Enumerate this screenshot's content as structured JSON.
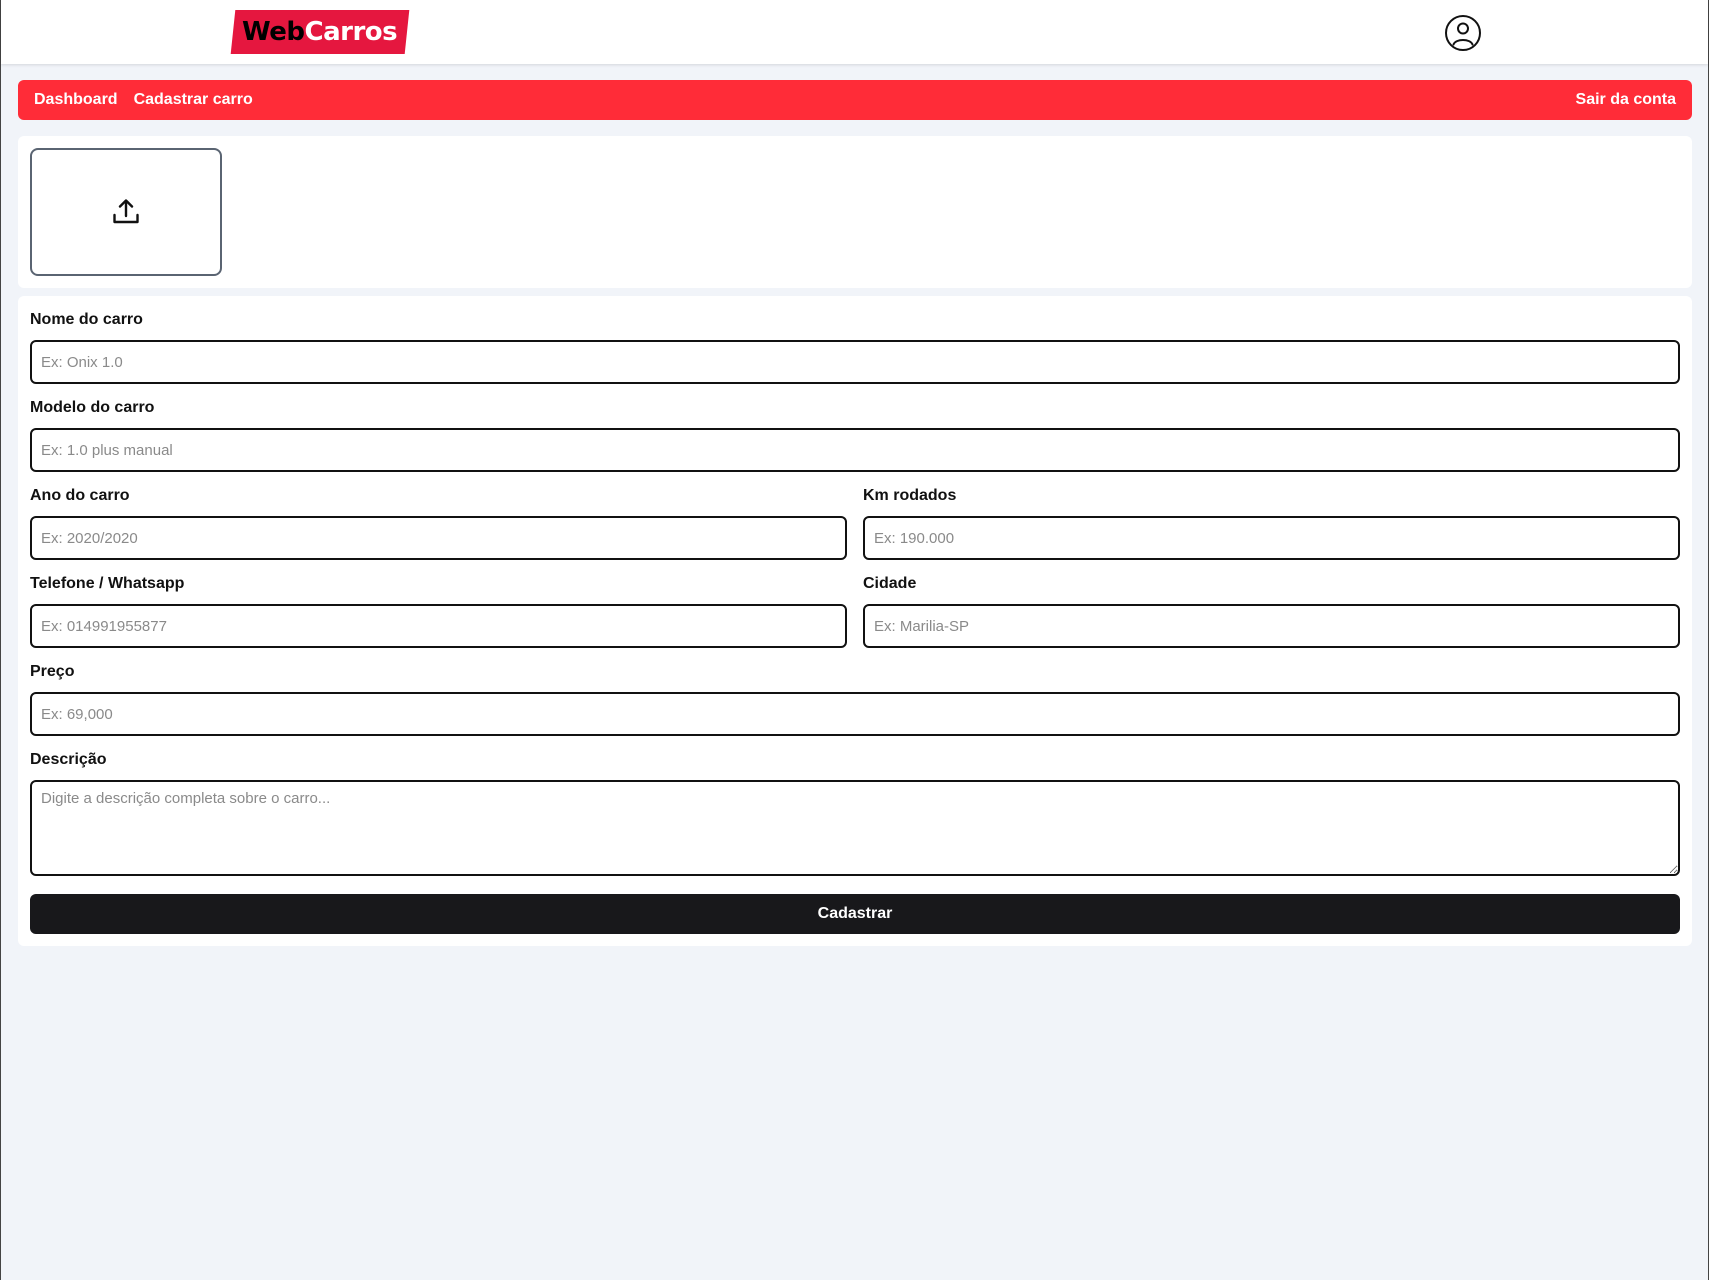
{
  "header": {
    "logo_part1": "Web",
    "logo_part2": "Carros",
    "brand_color": "#e5173f",
    "profile_icon": "user-circle-icon"
  },
  "nav": {
    "color": "#ff2c38",
    "dashboard": "Dashboard",
    "register_car": "Cadastrar carro",
    "logout": "Sair da conta"
  },
  "upload": {
    "icon": "upload-icon"
  },
  "form": {
    "name": {
      "label": "Nome do carro",
      "placeholder": "Ex: Onix 1.0"
    },
    "model": {
      "label": "Modelo do carro",
      "placeholder": "Ex: 1.0 plus manual"
    },
    "year": {
      "label": "Ano do carro",
      "placeholder": "Ex: 2020/2020"
    },
    "km": {
      "label": "Km rodados",
      "placeholder": "Ex: 190.000"
    },
    "phone": {
      "label": "Telefone / Whatsapp",
      "placeholder": "Ex: 014991955877"
    },
    "city": {
      "label": "Cidade",
      "placeholder": "Ex: Marilia-SP"
    },
    "price": {
      "label": "Preço",
      "placeholder": "Ex: 69,000"
    },
    "description": {
      "label": "Descrição",
      "placeholder": "Digite a descrição completa sobre o carro..."
    },
    "submit": "Cadastrar"
  }
}
